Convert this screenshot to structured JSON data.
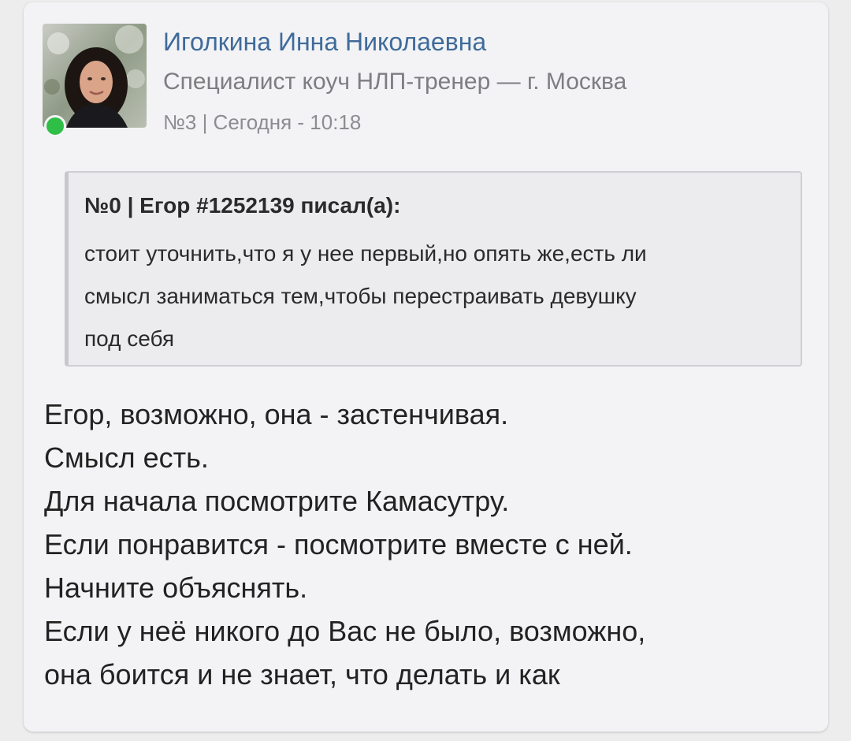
{
  "colors": {
    "accent": "#3f6b9a",
    "online": "#2fbf46",
    "card_background": "#f3f3f5",
    "quote_background": "#ececee"
  },
  "post": {
    "author": {
      "name": "Иголкина Инна Николаевна",
      "title": "Специалист коуч НЛП-тренер — г. Москва",
      "avatar": "user-photo",
      "online": true
    },
    "meta": "№3 | Сегодня - 10:18",
    "quote": {
      "header": "№0 | Егор #1252139 писал(а):",
      "lines": [
        "стоит уточнить,что я у нее первый,но опять же,есть ли",
        "смысл заниматься тем,чтобы перестраивать девушку",
        "под себя"
      ]
    },
    "body_lines": [
      "Егор, возможно, она - застенчивая.",
      "Смысл есть.",
      "Для начала посмотрите Камасутру.",
      "Если понравится - посмотрите вместе с ней.",
      "Начните объяснять.",
      "Если у неё никого до Вас не было, возможно,",
      "она боится и не знает, что делать и как"
    ]
  }
}
